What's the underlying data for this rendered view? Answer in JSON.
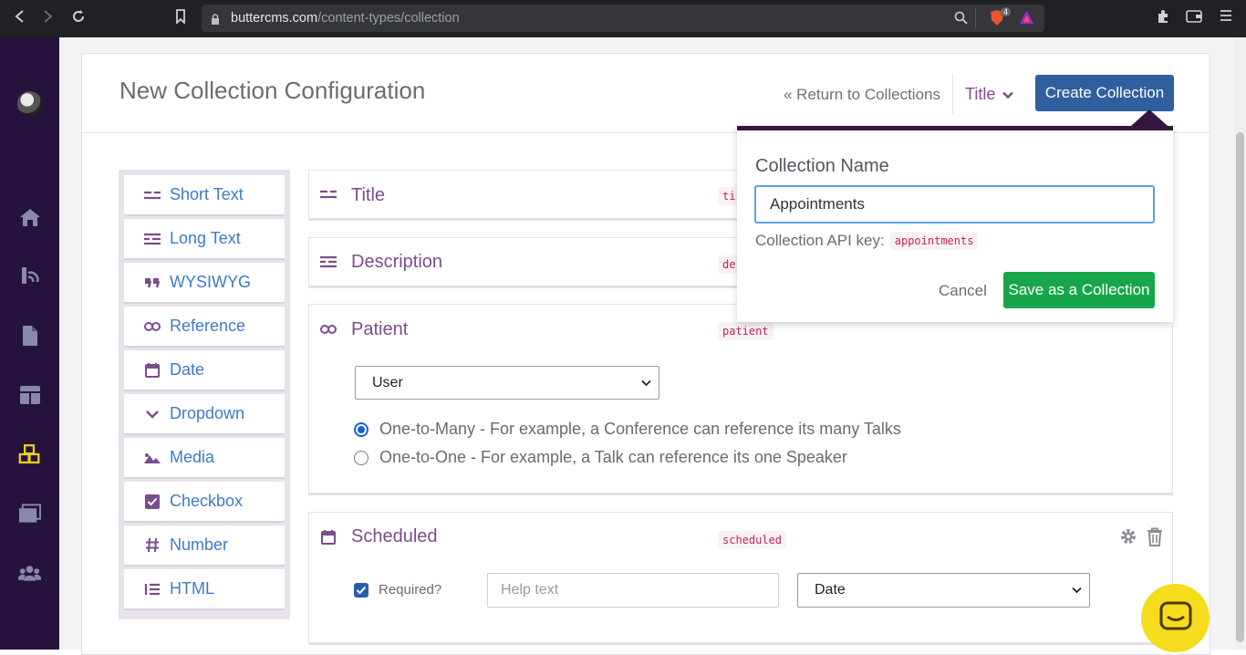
{
  "browser": {
    "url_domain": "buttercms.com",
    "url_path": "/content-types/collection",
    "brave_badge": "4"
  },
  "header": {
    "title": "New Collection Configuration",
    "return_link": "« Return to Collections",
    "title_select": "Title",
    "create_button": "Create Collection"
  },
  "palette": {
    "items": [
      {
        "label": "Short Text",
        "icon": "short-text-icon"
      },
      {
        "label": "Long Text",
        "icon": "long-text-icon"
      },
      {
        "label": "WYSIWYG",
        "icon": "quote-icon"
      },
      {
        "label": "Reference",
        "icon": "link-icon"
      },
      {
        "label": "Date",
        "icon": "calendar-icon"
      },
      {
        "label": "Dropdown",
        "icon": "chevron-down-icon"
      },
      {
        "label": "Media",
        "icon": "image-icon"
      },
      {
        "label": "Checkbox",
        "icon": "checkbox-icon"
      },
      {
        "label": "Number",
        "icon": "hash-icon"
      },
      {
        "label": "HTML",
        "icon": "list-icon"
      }
    ]
  },
  "fields": {
    "title": {
      "name": "Title",
      "key": "ti"
    },
    "description": {
      "name": "Description",
      "key": "de"
    },
    "patient": {
      "name": "Patient",
      "key": "patient",
      "reference_select": "User",
      "option_many": "One-to-Many - For example, a Conference can reference its many Talks",
      "option_one": "One-to-One - For example, a Talk can reference its one Speaker"
    },
    "scheduled": {
      "name": "Scheduled",
      "key": "scheduled",
      "required_label": "Required?",
      "help_placeholder": "Help text",
      "date_select": "Date"
    }
  },
  "popover": {
    "label": "Collection Name",
    "name_value": "Appointments",
    "api_label": "Collection API key:",
    "api_key": "appointments",
    "cancel": "Cancel",
    "save": "Save as a Collection"
  },
  "colors": {
    "sidebar": "#25133d",
    "primary_button": "#2f5f9e",
    "save_button": "#17a74a",
    "field_name": "#7a4d8c",
    "palette_label": "#3d7bc7",
    "chat_button": "#f5dc1c"
  }
}
